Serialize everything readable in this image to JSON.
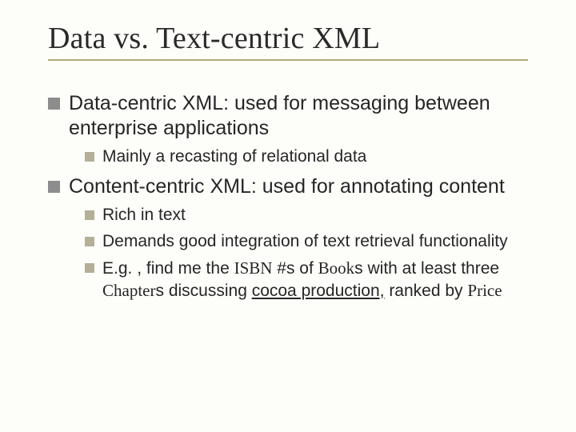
{
  "title": "Data vs. Text-centric XML",
  "bullets": {
    "a": {
      "text": "Data-centric XML: used for messaging between enterprise applications",
      "sub": {
        "a1": "Mainly a recasting of relational data"
      }
    },
    "b": {
      "text": "Content-centric XML: used for annotating content",
      "sub": {
        "b1": "Rich in text",
        "b2": "Demands good integration of text retrieval functionality",
        "b3_prefix": "E.g. , find me the ",
        "b3_isbn": "ISBN",
        "b3_mid1": " #s of ",
        "b3_book": "Book",
        "b3_mid2": "s with at least three ",
        "b3_chapter": "Chapter",
        "b3_mid3": "s discussing ",
        "b3_topic": "cocoa production,",
        "b3_end": " ranked by ",
        "b3_price": "Price"
      }
    }
  }
}
